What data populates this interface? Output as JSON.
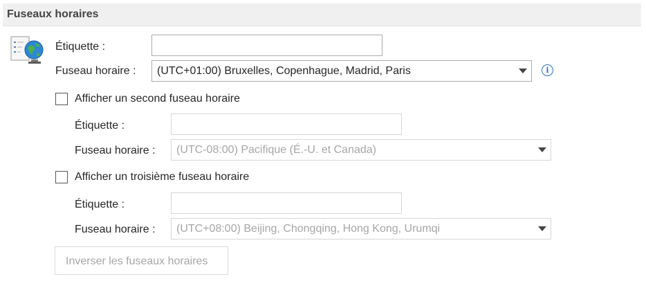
{
  "section": {
    "title": "Fuseaux horaires"
  },
  "primary": {
    "label_caption": "Étiquette :",
    "label_value": "",
    "timezone_caption": "Fuseau horaire :",
    "timezone_value": "(UTC+01:00) Bruxelles, Copenhague, Madrid, Paris",
    "info_icon": "i"
  },
  "second": {
    "checkbox_label": "Afficher un second fuseau horaire",
    "checked": false,
    "label_caption": "Étiquette :",
    "label_value": "",
    "timezone_caption": "Fuseau horaire :",
    "timezone_value": "(UTC-08:00) Pacifique (É.-U. et Canada)"
  },
  "third": {
    "checkbox_label": "Afficher un troisième fuseau horaire",
    "checked": false,
    "label_caption": "Étiquette :",
    "label_value": "",
    "timezone_caption": "Fuseau horaire :",
    "timezone_value": "(UTC+08:00) Beijing, Chongqing, Hong Kong, Urumqi"
  },
  "swap_button": {
    "label": "Inverser les fuseaux horaires"
  },
  "icons": {
    "globe": "globe-document-icon",
    "info": "info-icon",
    "dropdown": "chevron-down-icon"
  },
  "colors": {
    "header_bg": "#f0f0f0",
    "info_blue": "#2e6fbf",
    "disabled_text": "#a6a6a6"
  }
}
